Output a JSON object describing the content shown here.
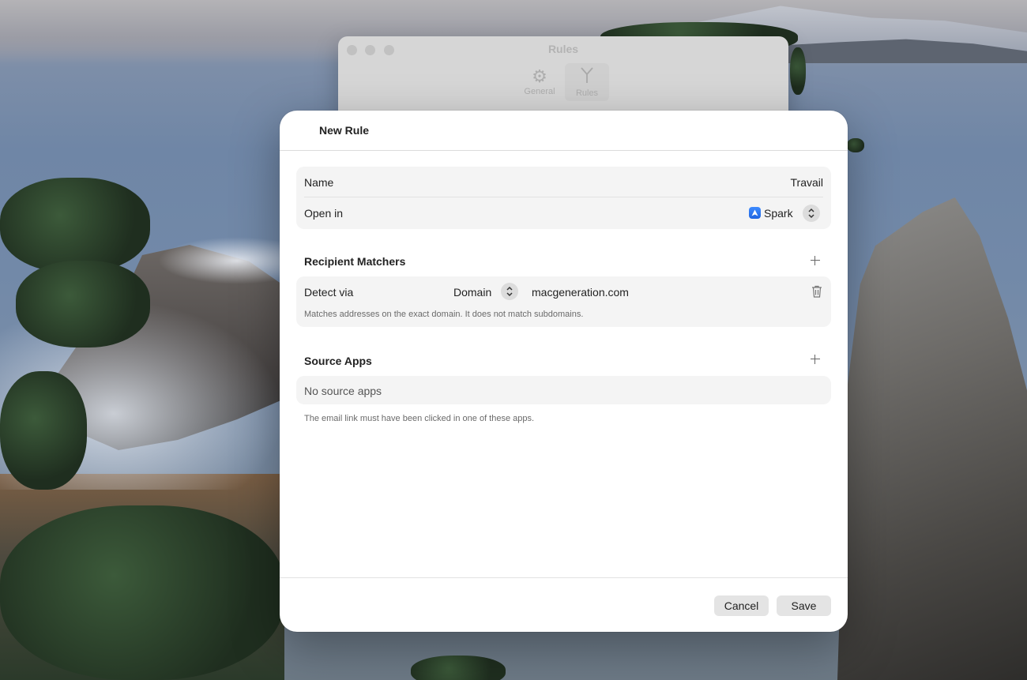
{
  "background_window": {
    "title": "Rules",
    "tabs": [
      {
        "label": "General",
        "icon": "gear-icon"
      },
      {
        "label": "Rules",
        "icon": "fork-icon"
      }
    ]
  },
  "sheet": {
    "title": "New Rule",
    "name": {
      "label": "Name",
      "value": "Travail"
    },
    "open_in": {
      "label": "Open in",
      "value": "Spark",
      "icon": "spark-app-icon"
    },
    "recipient_matchers": {
      "title": "Recipient Matchers",
      "matcher": {
        "label": "Detect via",
        "mode": "Domain",
        "value": "macgeneration.com"
      },
      "note": "Matches addresses on the exact domain. It does not match subdomains."
    },
    "source_apps": {
      "title": "Source Apps",
      "empty_text": "No source apps",
      "note": "The email link must have been clicked in one of these apps."
    },
    "buttons": {
      "cancel": "Cancel",
      "save": "Save"
    }
  },
  "colors": {
    "sheet_background": "#ffffff",
    "group_background": "#f4f4f4",
    "button_background": "#e4e4e4",
    "app_icon_blue": "#1f64e0"
  }
}
